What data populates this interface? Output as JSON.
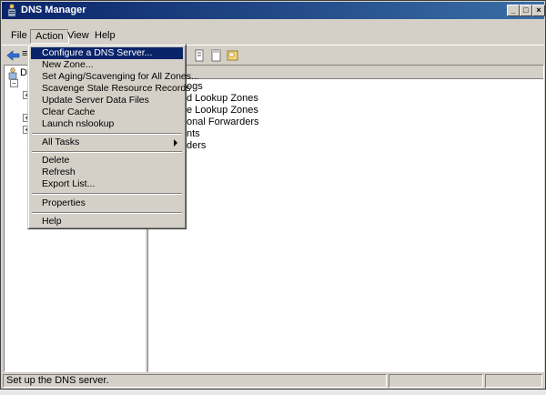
{
  "window": {
    "title": "DNS Manager"
  },
  "titlebar_buttons": [
    "_",
    "□",
    "×"
  ],
  "menubar": [
    {
      "label": "File"
    },
    {
      "label": "Action"
    },
    {
      "label": "View"
    },
    {
      "label": "Help"
    }
  ],
  "toolbar_visible_glyph": "≡",
  "tree": {
    "root_label_partial": "D",
    "expanders": [
      "−",
      "+",
      "+",
      "+"
    ]
  },
  "list": {
    "rows": [
      "ogs",
      "d Lookup Zones",
      "e Lookup Zones",
      "onal Forwarders",
      "nts",
      "ders"
    ]
  },
  "context_menu": {
    "items": [
      {
        "label": "Configure a DNS Server...",
        "highlighted": true
      },
      {
        "label": "New Zone..."
      },
      {
        "label": "Set Aging/Scavenging for All Zones..."
      },
      {
        "label": "Scavenge Stale Resource Records"
      },
      {
        "label": "Update Server Data Files"
      },
      {
        "label": "Clear Cache"
      },
      {
        "label": "Launch nslookup"
      },
      {
        "label": "All Tasks",
        "submenu": true
      },
      {
        "label": "Delete"
      },
      {
        "label": "Refresh"
      },
      {
        "label": "Export List..."
      },
      {
        "label": "Properties"
      },
      {
        "label": "Help"
      }
    ]
  },
  "status": {
    "text": "Set up the DNS server."
  },
  "colors": {
    "title_bar": "#0a246a",
    "highlight": "#0a246a",
    "face": "#d4d0c8"
  }
}
